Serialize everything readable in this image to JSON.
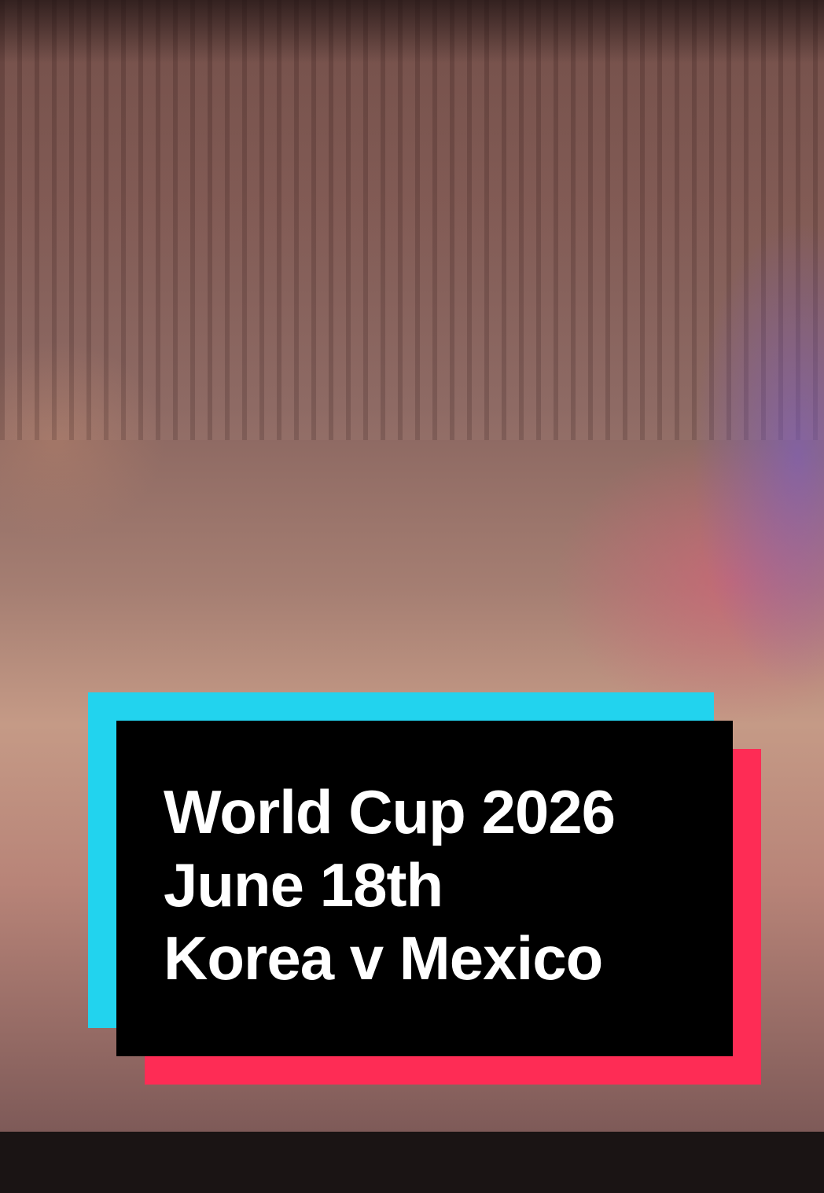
{
  "video": {
    "caption_lines": [
      "World Cup 2026",
      "June 18th",
      "Korea v Mexico"
    ]
  },
  "colors": {
    "caption_background": "#000000",
    "caption_text": "#ffffff",
    "caption_edge_left": "#22d3ee",
    "caption_edge_right": "#fe2c55",
    "bottom_bar": "#1a1414"
  }
}
